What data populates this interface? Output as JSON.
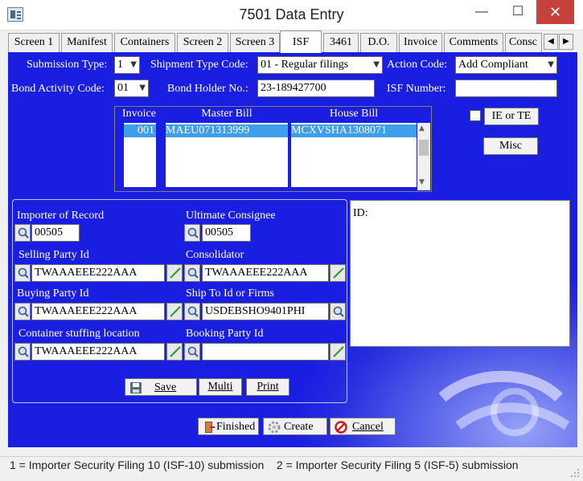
{
  "window": {
    "title": "7501 Data Entry",
    "minimize": "—",
    "maximize": "☐",
    "close": "✕"
  },
  "tabs": [
    "Screen 1",
    "Manifest",
    "Containers",
    "Screen 2",
    "Screen 3",
    "ISF",
    "3461",
    "D.O.",
    "Invoice",
    "Comments",
    "Consc"
  ],
  "active_tab": "ISF",
  "tab_scroll": {
    "left": "◀",
    "right": "▶"
  },
  "form": {
    "submission_type_label": "Submission Type:",
    "submission_type_value": "1",
    "shipment_type_label": "Shipment Type Code:",
    "shipment_type_value": "01 - Regular filings",
    "action_code_label": "Action Code:",
    "action_code_value": "Add Compliant",
    "bond_activity_label": "Bond Activity Code:",
    "bond_activity_value": "01",
    "bond_holder_label": "Bond Holder No.:",
    "bond_holder_value": "23-189427700",
    "isf_number_label": "ISF Number:",
    "isf_number_value": ""
  },
  "grid": {
    "headers": [
      "Invoice",
      "Master Bill",
      "House Bill"
    ],
    "rows": [
      {
        "invoice": "001",
        "master_bill": "MAEU071313999",
        "house_bill": "MCXVSHA1308071"
      }
    ]
  },
  "side_buttons": {
    "ie_te": "IE or TE",
    "misc": "Misc"
  },
  "parties": {
    "importer_label": "Importer of Record",
    "importer_value": "00505",
    "consignee_label": "Ultimate Consignee",
    "consignee_value": "00505",
    "selling_label": "Selling Party Id",
    "selling_value": "TWAAAEEE222AAA",
    "consolidator_label": "Consolidator",
    "consolidator_value": "TWAAAEEE222AAA",
    "buying_label": "Buying Party Id",
    "buying_value": "TWAAAEEE222AAA",
    "shipto_label": "Ship To Id or Firms",
    "shipto_value": "USDEBSHO9401PHI",
    "stuffing_label": "Container stuffing location",
    "stuffing_value": "TWAAAEEE222AAA",
    "booking_label": "Booking Party Id",
    "booking_value": ""
  },
  "group_buttons": {
    "save": "Save",
    "multi": "Multi",
    "print": "Print"
  },
  "id_label": "ID:",
  "bottom_buttons": {
    "finished": "Finished",
    "create": "Create",
    "cancel": "Cancel"
  },
  "status": "1 = Importer Security Filing 10 (ISF-10) submission    2 = Importer Security Filing 5 (ISF-5) submission",
  "colors": {
    "panel_blue": "#1a1ee0",
    "selected_row": "#3e9ee9",
    "close_red": "#c7413b"
  }
}
